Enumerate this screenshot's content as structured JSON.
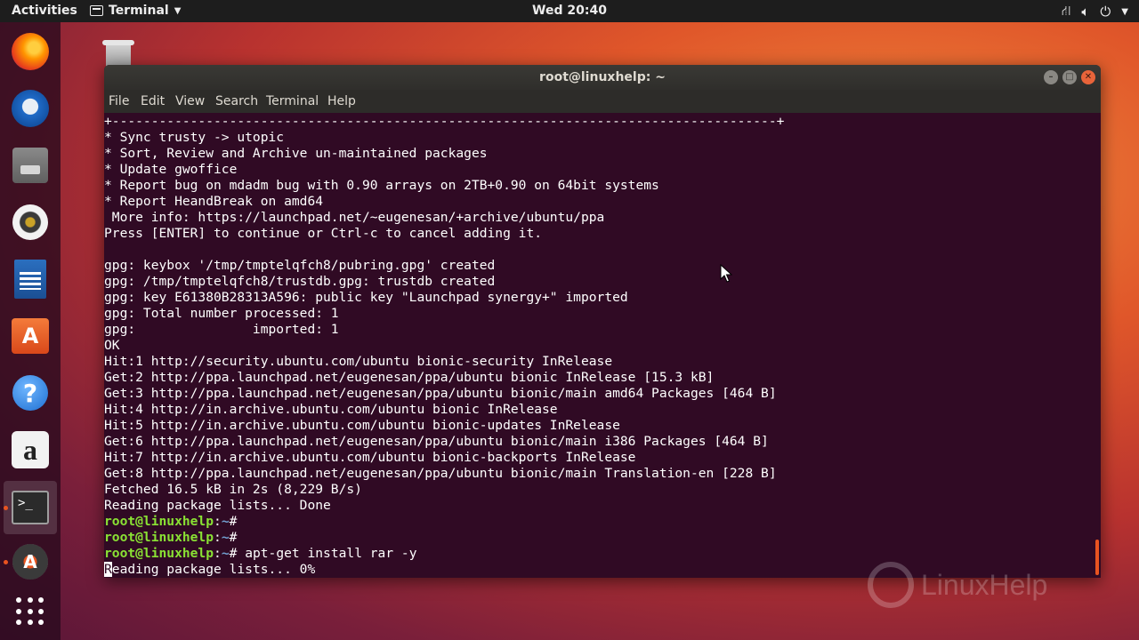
{
  "topbar": {
    "activities": "Activities",
    "app_name": "Terminal",
    "clock": "Wed 20:40",
    "tray": {
      "network_icon": "network-icon",
      "volume_icon": "volume-icon",
      "power_icon": "power-icon"
    }
  },
  "dock": {
    "items": [
      {
        "name": "firefox",
        "icon": "firefox-icon"
      },
      {
        "name": "thunderbird",
        "icon": "thunderbird-icon"
      },
      {
        "name": "files",
        "icon": "files-icon"
      },
      {
        "name": "rhythmbox",
        "icon": "rhythmbox-icon"
      },
      {
        "name": "libreoffice-writer",
        "icon": "writer-icon"
      },
      {
        "name": "ubuntu-software",
        "icon": "software-icon",
        "glyph": "A"
      },
      {
        "name": "help",
        "icon": "help-icon",
        "glyph": "?"
      },
      {
        "name": "amazon",
        "icon": "amazon-icon",
        "glyph": "a"
      },
      {
        "name": "terminal",
        "icon": "terminal-icon",
        "glyph": ">_",
        "active": true
      },
      {
        "name": "software-updater",
        "icon": "updater-icon",
        "glyph": "A"
      },
      {
        "name": "show-applications",
        "icon": "app-grid-icon"
      }
    ]
  },
  "window": {
    "title": "root@linuxhelp: ~",
    "menu": [
      "File",
      "Edit",
      "View",
      "Search",
      "Terminal",
      "Help"
    ]
  },
  "terminal": {
    "lines": [
      "+-------------------------------------------------------------------------------------+",
      "* Sync trusty -> utopic",
      "* Sort, Review and Archive un-maintained packages",
      "* Update gwoffice",
      "* Report bug on mdadm bug with 0.90 arrays on 2TB+0.90 on 64bit systems",
      "* Report HeandBreak on amd64",
      " More info: https://launchpad.net/~eugenesan/+archive/ubuntu/ppa",
      "Press [ENTER] to continue or Ctrl-c to cancel adding it.",
      "",
      "gpg: keybox '/tmp/tmptelqfch8/pubring.gpg' created",
      "gpg: /tmp/tmptelqfch8/trustdb.gpg: trustdb created",
      "gpg: key E61380B28313A596: public key \"Launchpad synergy+\" imported",
      "gpg: Total number processed: 1",
      "gpg:               imported: 1",
      "OK",
      "Hit:1 http://security.ubuntu.com/ubuntu bionic-security InRelease",
      "Get:2 http://ppa.launchpad.net/eugenesan/ppa/ubuntu bionic InRelease [15.3 kB]",
      "Get:3 http://ppa.launchpad.net/eugenesan/ppa/ubuntu bionic/main amd64 Packages [464 B]",
      "Hit:4 http://in.archive.ubuntu.com/ubuntu bionic InRelease",
      "Hit:5 http://in.archive.ubuntu.com/ubuntu bionic-updates InRelease",
      "Get:6 http://ppa.launchpad.net/eugenesan/ppa/ubuntu bionic/main i386 Packages [464 B]",
      "Hit:7 http://in.archive.ubuntu.com/ubuntu bionic-backports InRelease",
      "Get:8 http://ppa.launchpad.net/eugenesan/ppa/ubuntu bionic/main Translation-en [228 B]",
      "Fetched 16.5 kB in 2s (8,229 B/s)",
      "Reading package lists... Done"
    ],
    "prompt_user": "root@linuxhelp",
    "prompt_sep": ":",
    "prompt_path": "~",
    "prompt_end": "# ",
    "commands": [
      "",
      "",
      "apt-get install rar -y"
    ],
    "current_first_char": "R",
    "current_rest": "eading package lists... 0%"
  },
  "watermark": "LinuxHelp",
  "colors": {
    "terminal_bg": "#300a24",
    "prompt_user": "#8ae234",
    "prompt_path": "#729fcf",
    "accent": "#e95420"
  }
}
